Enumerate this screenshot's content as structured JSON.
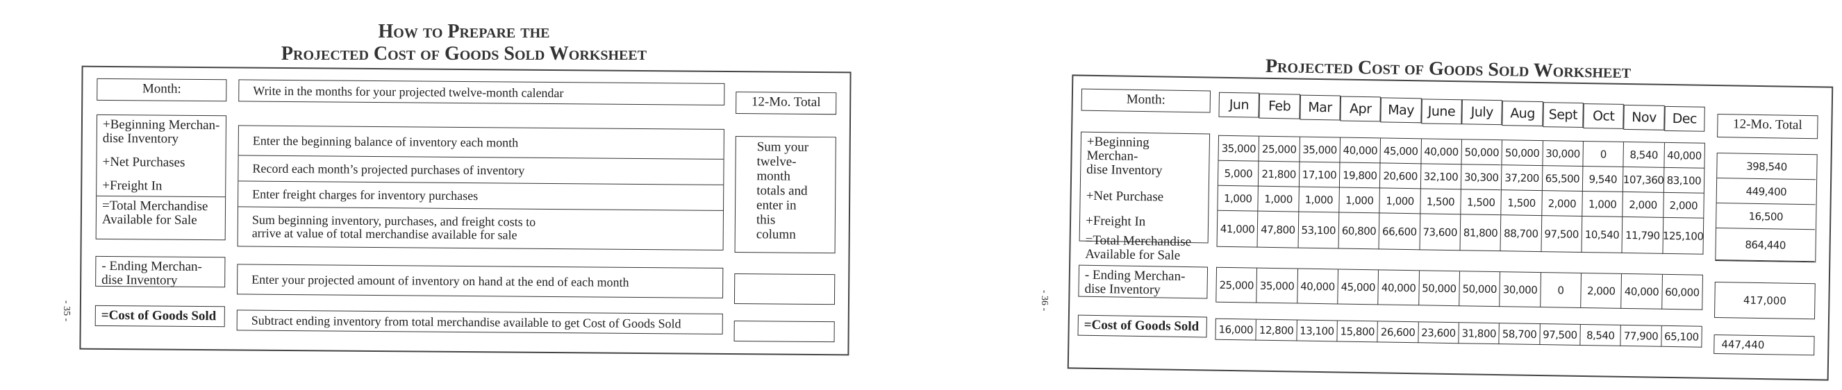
{
  "left_page": {
    "title_line1": "How to Prepare the",
    "title_line2": "Projected Cost of Goods Sold Worksheet",
    "page_number": "- 35 -",
    "month_label": "Month:",
    "month_desc": "Write in the months for your projected twelve-month calendar",
    "total_label": "12-Mo. Total",
    "rows": [
      {
        "label": "+Beginning Merchan-\ndise Inventory",
        "desc": "Enter the beginning balance of inventory each month"
      },
      {
        "label": "+Net Purchases",
        "desc": "Record each month’s projected purchases of inventory"
      },
      {
        "label": "+Freight In",
        "desc": "Enter freight charges for inventory purchases"
      },
      {
        "label": "=Total Merchandise\nAvailable for Sale",
        "desc": "Sum beginning inventory, purchases, and freight costs to\narrive at value of total merchandise available for sale"
      }
    ],
    "total_note": "Sum your\ntwelve-\nmonth\ntotals and\nenter in\nthis\ncolumn",
    "ending_label": "- Ending Merchan-\ndise Inventory",
    "ending_desc": "Enter your projected amount of inventory on hand at the end of each month",
    "cogs_label": "=Cost of Goods Sold",
    "cogs_desc": "Subtract ending inventory from total merchandise available to get Cost of Goods Sold"
  },
  "right_page": {
    "title": "Projected Cost of Goods Sold Worksheet",
    "page_number": "- 36 -",
    "month_label": "Month:",
    "months": [
      "Jun",
      "Feb",
      "Mar",
      "Apr",
      "May",
      "June",
      "July",
      "Aug",
      "Sept",
      "Oct",
      "Nov",
      "Dec"
    ],
    "total_label": "12-Mo. Total",
    "rows": [
      {
        "label": "+Beginning Merchan-\ndise Inventory",
        "values": [
          "35,000",
          "25,000",
          "35,000",
          "40,000",
          "45,000",
          "40,000",
          "50,000",
          "50,000",
          "30,000",
          "0",
          "8,540",
          "40,000"
        ],
        "total": "398,540"
      },
      {
        "label": "+Net Purchase",
        "values": [
          "5,000",
          "21,800",
          "17,100",
          "19,800",
          "20,600",
          "32,100",
          "30,300",
          "37,200",
          "65,500",
          "9,540",
          "107,360",
          "83,100"
        ],
        "total": "449,400"
      },
      {
        "label": "+Freight In",
        "values": [
          "1,000",
          "1,000",
          "1,000",
          "1,000",
          "1,000",
          "1,500",
          "1,500",
          "1,500",
          "2,000",
          "1,000",
          "2,000",
          "2,000"
        ],
        "total": "16,500"
      },
      {
        "label": "=Total Merchandise\nAvailable for Sale",
        "values": [
          "41,000",
          "47,800",
          "53,100",
          "60,800",
          "66,600",
          "73,600",
          "81,800",
          "88,700",
          "97,500",
          "10,540",
          "11,790",
          "125,100"
        ],
        "total": "864,440"
      }
    ],
    "ending": {
      "label": "- Ending Merchan-\ndise Inventory",
      "values": [
        "25,000",
        "35,000",
        "40,000",
        "45,000",
        "40,000",
        "50,000",
        "50,000",
        "30,000",
        "0",
        "2,000",
        "40,000",
        "60,000"
      ],
      "total": "417,000"
    },
    "cogs": {
      "label": "=Cost of Goods Sold",
      "values": [
        "16,000",
        "12,800",
        "13,100",
        "15,800",
        "26,600",
        "23,600",
        "31,800",
        "58,700",
        "97,500",
        "8,540",
        "77,900",
        "65,100"
      ],
      "total": "447,440"
    }
  }
}
